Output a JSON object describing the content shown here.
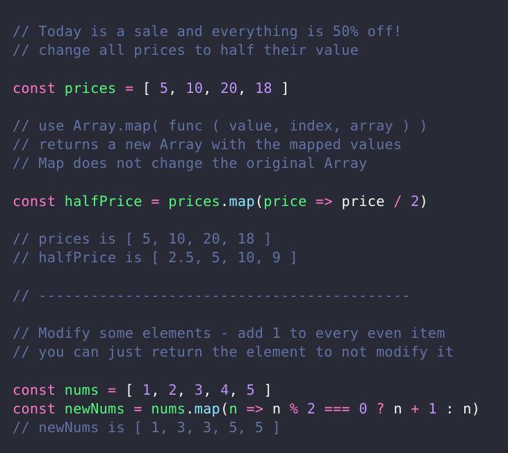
{
  "code": {
    "c1": "// Today is a sale and everything is 50% off!",
    "c2": "// change all prices to half their value",
    "prices": {
      "kw": "const",
      "name": "prices",
      "eq": "=",
      "open": "[",
      "n1": "5",
      "n2": "10",
      "n3": "20",
      "n4": "18",
      "close": "]"
    },
    "c3": "// use Array.map( func ( value, index, array ) )",
    "c4": "// returns a new Array with the mapped values",
    "c5": "// Map does not change the original Array",
    "half": {
      "kw": "const",
      "name": "halfPrice",
      "eq": "=",
      "obj": "prices",
      "dot": ".",
      "method": "map",
      "paren_open": "(",
      "param": "price",
      "arrow": "=>",
      "ref": "price",
      "div": "/",
      "two": "2",
      "paren_close": ")"
    },
    "c6": "// prices is [ 5, 10, 20, 18 ]",
    "c7": "// halfPrice is [ 2.5, 5, 10, 9 ]",
    "c8": "// -------------------------------------------",
    "c9": "// Modify some elements - add 1 to every even item",
    "c10": "// you can just return the element to not modify it",
    "nums": {
      "kw": "const",
      "name": "nums",
      "eq": "=",
      "open": "[",
      "n1": "1",
      "n2": "2",
      "n3": "3",
      "n4": "4",
      "n5": "5",
      "close": "]"
    },
    "newnums": {
      "kw": "const",
      "name": "newNums",
      "eq": "=",
      "obj": "nums",
      "dot": ".",
      "method": "map",
      "paren_open": "(",
      "param": "n",
      "arrow": "=>",
      "ref1": "n",
      "mod": "%",
      "two": "2",
      "seq": "===",
      "zero": "0",
      "q": "?",
      "ref2": "n",
      "plus": "+",
      "one": "1",
      "colon": ":",
      "ref3": "n",
      "paren_close": ")"
    },
    "c11": "// newNums is [ 1, 3, 3, 5, 5 ]"
  },
  "colors": {
    "background": "#282a36",
    "comment": "#6272a4",
    "keyword": "#ff79c6",
    "variable": "#50fa7b",
    "number": "#bd93f9",
    "function": "#8be9fd",
    "text": "#f8f8f2"
  }
}
